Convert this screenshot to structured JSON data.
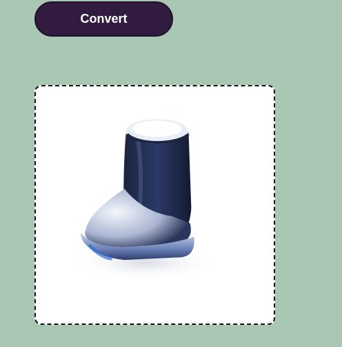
{
  "toolbar": {
    "convert_label": "Convert"
  },
  "image_panel": {
    "content": "boot-image"
  },
  "colors": {
    "background": "#aac7b4",
    "button_bg": "#311c3f",
    "button_text": "#ffffff",
    "panel_bg": "#ffffff",
    "panel_border": "#111111"
  }
}
